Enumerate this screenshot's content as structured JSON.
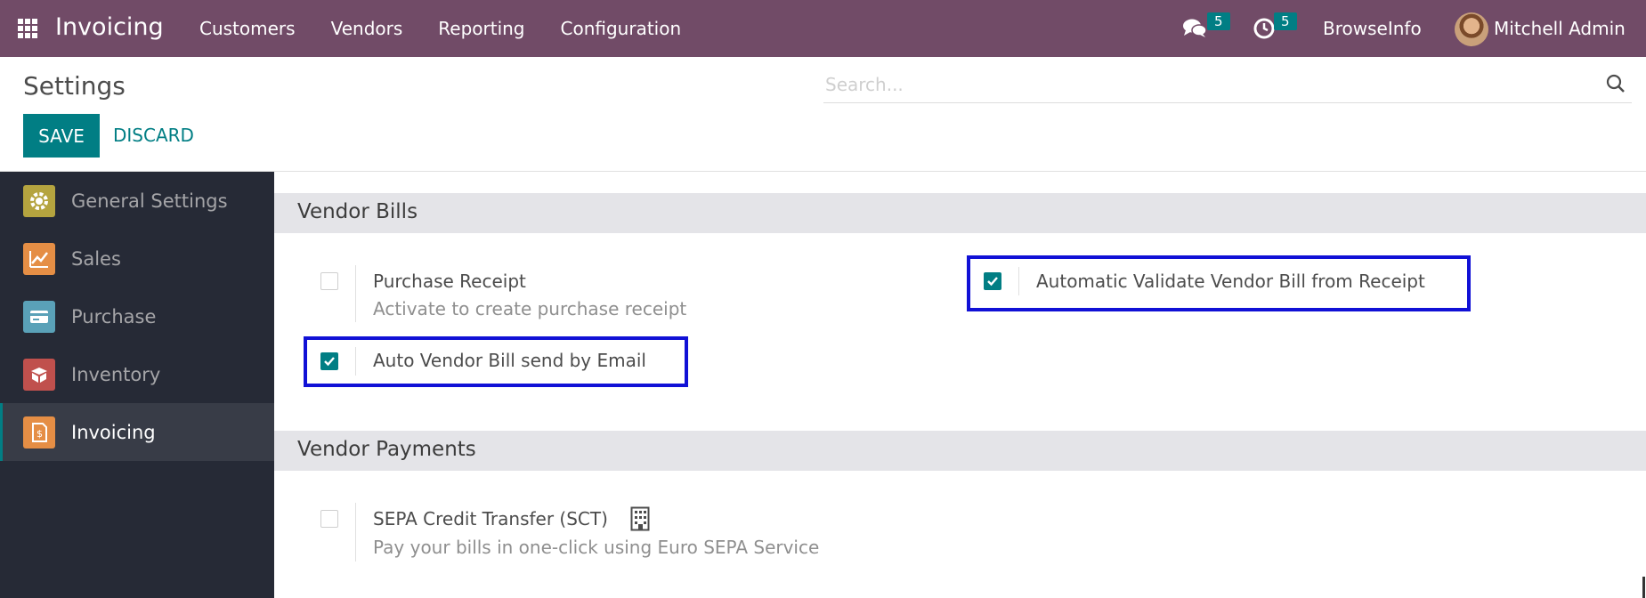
{
  "navbar": {
    "app_name": "Invoicing",
    "menu": [
      "Customers",
      "Vendors",
      "Reporting",
      "Configuration"
    ],
    "messages_count": "5",
    "activities_count": "5",
    "company": "BrowseInfo",
    "user": "Mitchell Admin",
    "icons": [
      "apps-grid-icon",
      "chat-icon",
      "clock-icon",
      "avatar"
    ]
  },
  "control_panel": {
    "title": "Settings",
    "search_placeholder": "Search...",
    "save_label": "SAVE",
    "discard_label": "DISCARD"
  },
  "sidebar": {
    "items": [
      {
        "label": "General Settings",
        "icon": "gear-icon",
        "color": "#b5a43f"
      },
      {
        "label": "Sales",
        "icon": "chart-icon",
        "color": "#e58e45"
      },
      {
        "label": "Purchase",
        "icon": "credit-card-icon",
        "color": "#5aa1b8"
      },
      {
        "label": "Inventory",
        "icon": "box-icon",
        "color": "#c0504d"
      },
      {
        "label": "Invoicing",
        "icon": "invoice-icon",
        "color": "#e58e45",
        "active": true
      }
    ]
  },
  "sections": {
    "vendor_bills": {
      "title": "Vendor Bills",
      "purchase_receipt": {
        "title": "Purchase Receipt",
        "description": "Activate to create purchase receipt",
        "checked": false
      },
      "auto_validate": {
        "title": "Automatic Validate Vendor Bill from Receipt",
        "checked": true,
        "highlighted": true
      },
      "auto_email": {
        "title": "Auto Vendor Bill send by Email",
        "checked": true,
        "highlighted": true
      }
    },
    "vendor_payments": {
      "title": "Vendor Payments",
      "sepa": {
        "title": "SEPA Credit Transfer (SCT)",
        "description": "Pay your bills in one-click using Euro SEPA Service",
        "checked": false,
        "icon": "building-icon"
      }
    }
  },
  "colors": {
    "navbar": "#714b67",
    "primary": "#017e84",
    "sidebar": "#262a36",
    "highlight": "#1111d6"
  }
}
